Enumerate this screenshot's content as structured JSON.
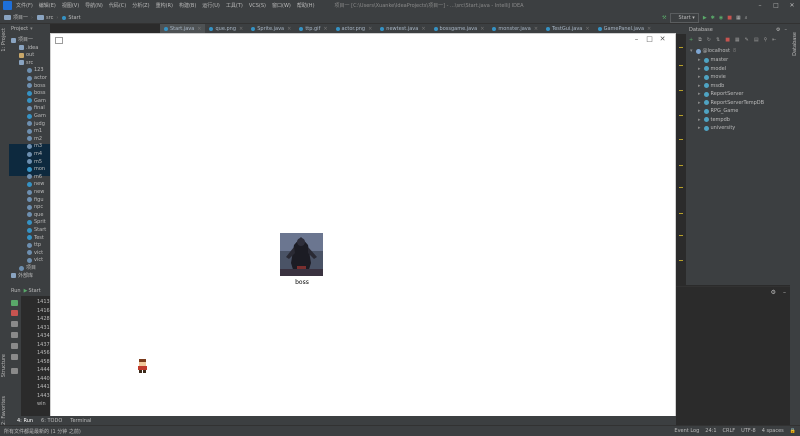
{
  "menu": {
    "items": [
      "文件(F)",
      "编辑(E)",
      "视图(V)",
      "导航(N)",
      "代码(C)",
      "分析(Z)",
      "重构(R)",
      "构建(B)",
      "运行(U)",
      "工具(T)",
      "VCS(S)",
      "窗口(W)",
      "帮助(H)"
    ],
    "window_title": "项目一 [C:\\Users\\Xuanke\\IdeaProjects\\项目一] - ...\\src\\Start.java - IntelliJ IDEA"
  },
  "nav": {
    "breadcrumbs": [
      "项目一",
      "src",
      "Start"
    ],
    "run_config": "Start"
  },
  "tabs": [
    "Start.java",
    "que.png",
    "Sprite.java",
    "ttp.gif",
    "actor.png",
    "newtest.java",
    "bossgame.java",
    "monster.java",
    "TestGui.java",
    "GamePanel.java"
  ],
  "project": {
    "title": "Project",
    "tree": [
      {
        "label": "项目一",
        "indent": 0,
        "kind": "folder"
      },
      {
        "label": ".idea",
        "indent": 1,
        "kind": "folder"
      },
      {
        "label": "out",
        "indent": 1,
        "kind": "folder-out"
      },
      {
        "label": "src",
        "indent": 1,
        "kind": "folder"
      },
      {
        "label": "123",
        "indent": 2,
        "kind": "file"
      },
      {
        "label": "actor",
        "indent": 2,
        "kind": "file"
      },
      {
        "label": "boss",
        "indent": 2,
        "kind": "file"
      },
      {
        "label": "boss",
        "indent": 2,
        "kind": "class"
      },
      {
        "label": "Gam",
        "indent": 2,
        "kind": "class"
      },
      {
        "label": "final",
        "indent": 2,
        "kind": "file"
      },
      {
        "label": "Gam",
        "indent": 2,
        "kind": "class"
      },
      {
        "label": "judg",
        "indent": 2,
        "kind": "file"
      },
      {
        "label": "m1",
        "indent": 2,
        "kind": "file"
      },
      {
        "label": "m2",
        "indent": 2,
        "kind": "file"
      },
      {
        "label": "m3",
        "indent": 2,
        "kind": "file"
      },
      {
        "label": "m4",
        "indent": 2,
        "kind": "file"
      },
      {
        "label": "m5",
        "indent": 2,
        "kind": "file"
      },
      {
        "label": "mon",
        "indent": 2,
        "kind": "class"
      },
      {
        "label": "m6",
        "indent": 2,
        "kind": "file"
      },
      {
        "label": "new",
        "indent": 2,
        "kind": "class"
      },
      {
        "label": "new",
        "indent": 2,
        "kind": "file"
      },
      {
        "label": "figu",
        "indent": 2,
        "kind": "file"
      },
      {
        "label": "npc",
        "indent": 2,
        "kind": "file"
      },
      {
        "label": "que",
        "indent": 2,
        "kind": "file"
      },
      {
        "label": "Sprit",
        "indent": 2,
        "kind": "class"
      },
      {
        "label": "Start",
        "indent": 2,
        "kind": "class"
      },
      {
        "label": "Test",
        "indent": 2,
        "kind": "class"
      },
      {
        "label": "ttp",
        "indent": 2,
        "kind": "file"
      },
      {
        "label": "vict",
        "indent": 2,
        "kind": "file"
      },
      {
        "label": "vict",
        "indent": 2,
        "kind": "file"
      },
      {
        "label": "项目",
        "indent": 1,
        "kind": "file"
      },
      {
        "label": "外部库",
        "indent": 0,
        "kind": "folder"
      }
    ]
  },
  "run": {
    "title": "Run",
    "config": "Start",
    "console_lines": [
      "1413",
      "1416",
      "1428",
      "1431",
      "1434",
      "1437",
      "1456",
      "1458",
      "1444",
      "1440",
      "1441",
      "1443",
      "win"
    ]
  },
  "game": {
    "boss_label": "boss"
  },
  "database": {
    "title": "Database",
    "root": "@localhost",
    "root_count": "8",
    "schemas": [
      "master",
      "model",
      "movie",
      "msdb",
      "ReportServer",
      "ReportServerTempDB",
      "RPG_Game",
      "tempdb",
      "university"
    ]
  },
  "side": {
    "structure": "Structure",
    "favorites": "2: Favorites",
    "project": "1: Project",
    "database": "Database"
  },
  "bottom_tabs": [
    "4: Run",
    "6: TODO",
    "Terminal"
  ],
  "status": {
    "message": "所有文件都是最新的 (1 分钟 之前)",
    "event_log": "Event Log",
    "position": "24:1",
    "line_sep": "CRLF",
    "encoding": "UTF-8",
    "indent": "4 spaces"
  },
  "colors": {
    "accent": "#4a88c7",
    "class_icon": "#3592c4",
    "run_green": "#59a869",
    "stop_red": "#c75450"
  }
}
